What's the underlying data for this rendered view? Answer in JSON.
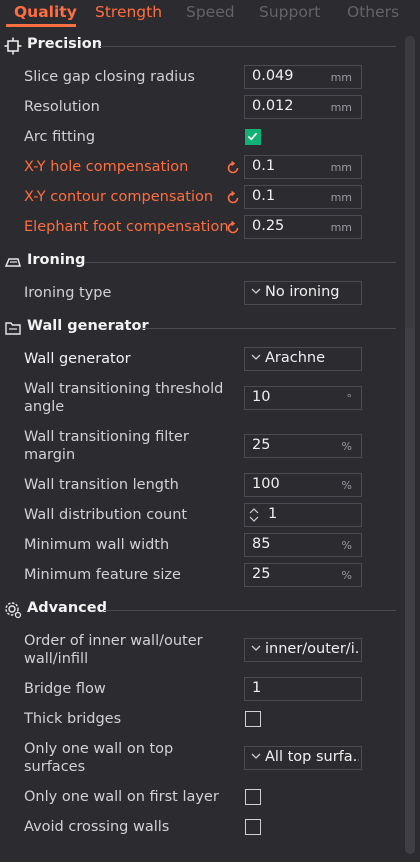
{
  "tabs": [
    {
      "label": "Quality"
    },
    {
      "label": "Strength"
    },
    {
      "label": "Speed"
    },
    {
      "label": "Support"
    },
    {
      "label": "Others"
    }
  ],
  "colors": {
    "accent": "#ff6e40",
    "check": "#12b075",
    "background": "#2b2b30"
  },
  "sections": {
    "precision": {
      "title": "Precision",
      "icon": "precision-icon",
      "rows": [
        {
          "label": "Slice gap closing radius",
          "value": "0.049",
          "unit": "mm"
        },
        {
          "label": "Resolution",
          "value": "0.012",
          "unit": "mm"
        },
        {
          "label": "Arc fitting",
          "checked": true
        },
        {
          "label": "X-Y hole compensation",
          "value": "0.1",
          "unit": "mm"
        },
        {
          "label": "X-Y contour compensation",
          "value": "0.1",
          "unit": "mm"
        },
        {
          "label": "Elephant foot compensation",
          "value": "0.25",
          "unit": "mm"
        }
      ]
    },
    "ironing": {
      "title": "Ironing",
      "icon": "ironing-icon",
      "rows": [
        {
          "label": "Ironing type",
          "value": "No ironing"
        }
      ]
    },
    "wall_generator": {
      "title": "Wall generator",
      "icon": "wall-generator-icon",
      "rows": [
        {
          "label": "Wall generator",
          "value": "Arachne"
        },
        {
          "label": "Wall transitioning threshold angle",
          "value": "10",
          "unit": "°"
        },
        {
          "label": "Wall transitioning filter margin",
          "value": "25",
          "unit": "%"
        },
        {
          "label": "Wall transition length",
          "value": "100",
          "unit": "%"
        },
        {
          "label": "Wall distribution count",
          "value": "1"
        },
        {
          "label": "Minimum wall width",
          "value": "85",
          "unit": "%"
        },
        {
          "label": "Minimum feature size",
          "value": "25",
          "unit": "%"
        }
      ]
    },
    "advanced": {
      "title": "Advanced",
      "icon": "advanced-gear-icon",
      "rows": [
        {
          "label": "Order of inner wall/outer wall/infill",
          "value": "inner/outer/i..."
        },
        {
          "label": "Bridge flow",
          "value": "1"
        },
        {
          "label": "Thick bridges",
          "checked": false
        },
        {
          "label": "Only one wall on top surfaces",
          "value": "All top surfa..."
        },
        {
          "label": "Only one wall on first layer",
          "checked": false
        },
        {
          "label": "Avoid crossing walls",
          "checked": false
        }
      ]
    }
  }
}
